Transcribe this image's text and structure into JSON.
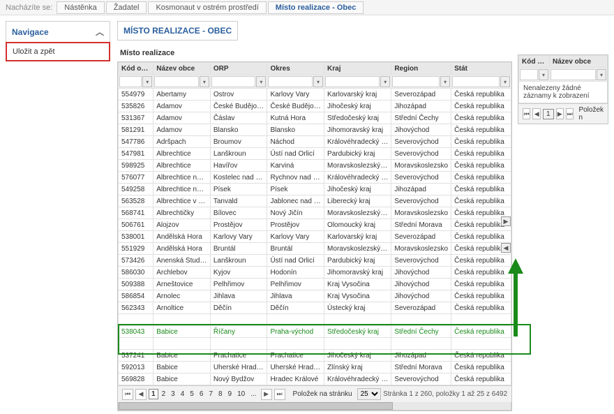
{
  "breadcrumb": {
    "label": "Nacházíte se:",
    "items": [
      {
        "label": "Nástěnka"
      },
      {
        "label": "Žadatel"
      },
      {
        "label": "Kosmonaut v ostrém prostředí"
      },
      {
        "label": "Místo realizace - Obec"
      }
    ]
  },
  "sidebar": {
    "nav_title": "Navigace",
    "save_back": "Uložit a zpět"
  },
  "section": {
    "title": "MÍSTO REALIZACE - OBEC",
    "subtitle": "Místo realizace"
  },
  "columns": {
    "kod": "Kód obce",
    "nazev": "Název obce",
    "orp": "ORP",
    "okres": "Okres",
    "kraj": "Kraj",
    "region": "Region",
    "stat": "Stát"
  },
  "rows": [
    [
      "554979",
      "Abertamy",
      "Ostrov",
      "Karlovy Vary",
      "Karlovarský kraj",
      "Severozápad",
      "Česká republika"
    ],
    [
      "535826",
      "Adamov",
      "České Budějovice",
      "České Budějovice",
      "Jihočeský kraj",
      "Jihozápad",
      "Česká republika"
    ],
    [
      "531367",
      "Adamov",
      "Čáslav",
      "Kutná Hora",
      "Středočeský kraj",
      "Střední Čechy",
      "Česká republika"
    ],
    [
      "581291",
      "Adamov",
      "Blansko",
      "Blansko",
      "Jihomoravský kraj",
      "Jihovýchod",
      "Česká republika"
    ],
    [
      "547786",
      "Adršpach",
      "Broumov",
      "Náchod",
      "Královéhradecký kraj",
      "Severovýchod",
      "Česká republika"
    ],
    [
      "547981",
      "Albrechtice",
      "Lanškroun",
      "Ústí nad Orlicí",
      "Pardubický kraj",
      "Severovýchod",
      "Česká republika"
    ],
    [
      "598925",
      "Albrechtice",
      "Havířov",
      "Karviná",
      "Moravskoslezský kraj",
      "Moravskoslezsko",
      "Česká republika"
    ],
    [
      "576077",
      "Albrechtice nad...",
      "Kostelec nad Orlicí",
      "Rychnov nad Kně...",
      "Královéhradecký kraj",
      "Severovýchod",
      "Česká republika"
    ],
    [
      "549258",
      "Albrechtice nad...",
      "Písek",
      "Písek",
      "Jihočeský kraj",
      "Jihozápad",
      "Česká republika"
    ],
    [
      "563528",
      "Albrechtice v Jiz...",
      "Tanvald",
      "Jablonec nad Nis...",
      "Liberecký kraj",
      "Severovýchod",
      "Česká republika"
    ],
    [
      "568741",
      "Albrechtičky",
      "Bílovec",
      "Nový Jičín",
      "Moravskoslezský kraj",
      "Moravskoslezsko",
      "Česká republika"
    ],
    [
      "506761",
      "Alojzov",
      "Prostějov",
      "Prostějov",
      "Olomoucký kraj",
      "Střední Morava",
      "Česká republika"
    ],
    [
      "538001",
      "Andělská Hora",
      "Karlovy Vary",
      "Karlovy Vary",
      "Karlovarský kraj",
      "Severozápad",
      "Česká republika"
    ],
    [
      "551929",
      "Andělská Hora",
      "Bruntál",
      "Bruntál",
      "Moravskoslezský kraj",
      "Moravskoslezsko",
      "Česká republika"
    ],
    [
      "573426",
      "Anenská Studánka",
      "Lanškroun",
      "Ústí nad Orlicí",
      "Pardubický kraj",
      "Severovýchod",
      "Česká republika"
    ],
    [
      "586030",
      "Archlebov",
      "Kyjov",
      "Hodonín",
      "Jihomoravský kraj",
      "Jihovýchod",
      "Česká republika"
    ],
    [
      "509388",
      "Arneštovice",
      "Pelhřimov",
      "Pelhřimov",
      "Kraj Vysočina",
      "Jihovýchod",
      "Česká republika"
    ],
    [
      "586854",
      "Arnolec",
      "Jihlava",
      "Jihlava",
      "Kraj Vysočina",
      "Jihovýchod",
      "Česká republika"
    ],
    [
      "562343",
      "Arnoltice",
      "Děčín",
      "Děčín",
      "Ústecký kraj",
      "Severozápad",
      "Česká republika"
    ],
    [
      "",
      "",
      "",
      "",
      "",
      "",
      ""
    ],
    [
      "538043",
      "Babice",
      "Říčany",
      "Praha-východ",
      "Středočeský kraj",
      "Střední Čechy",
      "Česká republika"
    ],
    [
      "",
      "",
      "",
      "",
      "",
      "",
      ""
    ],
    [
      "537241",
      "Babice",
      "Prachatice",
      "Prachatice",
      "Jihočeský kraj",
      "Jihozápad",
      "Česká republika"
    ],
    [
      "592013",
      "Babice",
      "Uherské Hradiště",
      "Uherské Hradiště",
      "Zlínský kraj",
      "Střední Morava",
      "Česká republika"
    ],
    [
      "569828",
      "Babice",
      "Nový Bydžov",
      "Hradec Králové",
      "Královéhradecký kraj",
      "Severovýchod",
      "Česká republika"
    ]
  ],
  "pager": {
    "pages": [
      "1",
      "2",
      "3",
      "4",
      "5",
      "6",
      "7",
      "8",
      "9",
      "10",
      "..."
    ],
    "page_size_label": "Položek na stránku",
    "page_size": "25",
    "summary": "Stránka 1 z 260, položky 1 až 25 z 6492"
  },
  "right_panel": {
    "no_data": "Nenalezeny žádné záznamy k zobrazení",
    "page_size_label": "Položek n"
  }
}
